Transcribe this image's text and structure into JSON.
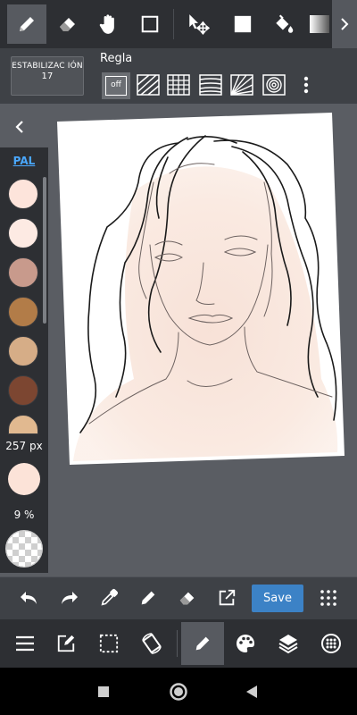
{
  "top_toolbar": {
    "tools": [
      {
        "icon": "pen-icon",
        "active": true
      },
      {
        "icon": "eraser-icon",
        "active": false
      },
      {
        "icon": "hand-icon",
        "active": false
      },
      {
        "icon": "rectangle-select-icon",
        "active": false
      },
      {
        "icon": "move-transform-icon",
        "active": false
      },
      {
        "icon": "fill-color-icon",
        "active": false
      },
      {
        "icon": "paint-bucket-icon",
        "active": false
      },
      {
        "icon": "gradient-icon",
        "active": false
      }
    ],
    "more_icon": "chevron-right-icon"
  },
  "sub_toolbar": {
    "stabilization_label": "ESTABILIZAC IÓN",
    "stabilization_value": "17",
    "ruler_label": "Regla",
    "ruler_off_label": "off",
    "ruler_options": [
      "parallel-ruler-icon",
      "grid-ruler-icon",
      "perspective-ruler-icon",
      "radial-ruler-icon",
      "concentric-ruler-icon"
    ]
  },
  "palette": {
    "title": "PAL",
    "swatches": [
      "#fde4db",
      "#fdeae3",
      "#c89a8c",
      "#b27c48",
      "#d6ad87",
      "#7c4631",
      "#e1b990"
    ],
    "brush_size": "257 px",
    "opacity": "9 %",
    "current_color": "#fce3d8"
  },
  "action_bar": {
    "save_label": "Save"
  },
  "bottom_toolbar": {
    "tools": [
      "menu-icon",
      "edit-canvas-icon",
      "selection-icon",
      "rotate-canvas-icon",
      "brush-icon",
      "color-palette-icon",
      "layers-icon",
      "material-icon"
    ]
  },
  "colors": {
    "accent": "#3c82c6",
    "panel_dark": "#2d2f33",
    "panel_mid": "#3e4146",
    "workspace": "#5a5d63"
  }
}
